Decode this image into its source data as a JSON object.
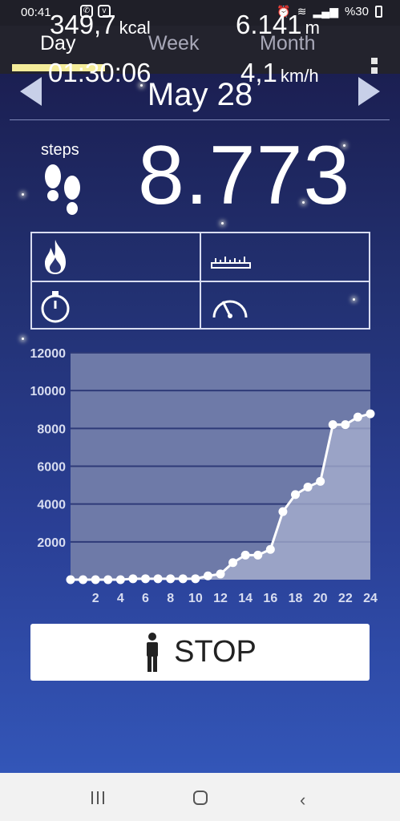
{
  "statusbar": {
    "time": "00:41",
    "battery": "%30"
  },
  "tabs": [
    {
      "label": "Day"
    },
    {
      "label": "Week"
    },
    {
      "label": "Month"
    }
  ],
  "date_nav": {
    "date": "May 28"
  },
  "summary": {
    "steps_label": "steps",
    "steps_value": "8.773"
  },
  "stats": {
    "calories": {
      "value": "349,7",
      "unit": "kcal"
    },
    "distance": {
      "value": "6.141",
      "unit": "m"
    },
    "duration": {
      "value": "01:30:06"
    },
    "speed": {
      "value": "4,1",
      "unit": "km/h"
    }
  },
  "stop_button": {
    "label": "STOP"
  },
  "colors": {
    "accent": "#f4ec9a",
    "chart_bg": "#6e7aa8",
    "chart_fill": "#a9b2d0"
  },
  "chart_data": {
    "type": "line",
    "x": [
      0,
      1,
      2,
      3,
      4,
      5,
      6,
      7,
      8,
      9,
      10,
      11,
      12,
      13,
      14,
      15,
      16,
      17,
      18,
      19,
      20,
      21,
      22,
      23,
      24
    ],
    "xticks": [
      2,
      4,
      6,
      8,
      10,
      12,
      14,
      16,
      18,
      20,
      22,
      24
    ],
    "series": [
      {
        "values": [
          0,
          0,
          0,
          0,
          0,
          50,
          50,
          50,
          50,
          50,
          50,
          200,
          300,
          900,
          1300,
          1300,
          1600,
          3600,
          4500,
          4900,
          5200,
          8200,
          8200,
          8600,
          8773
        ]
      }
    ],
    "ylim": [
      0,
      12000
    ],
    "yticks": [
      2000,
      4000,
      6000,
      8000,
      10000,
      12000
    ],
    "grid": true,
    "title": "",
    "xlabel": "",
    "ylabel": ""
  }
}
